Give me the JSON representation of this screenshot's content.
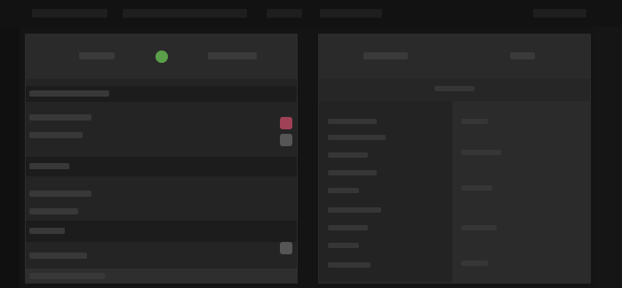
{
  "ui": {
    "theme_colors": {
      "background": "#141414",
      "panel": "#242424",
      "accent_green": "#5aa04a",
      "accent_red": "#a04158"
    }
  }
}
